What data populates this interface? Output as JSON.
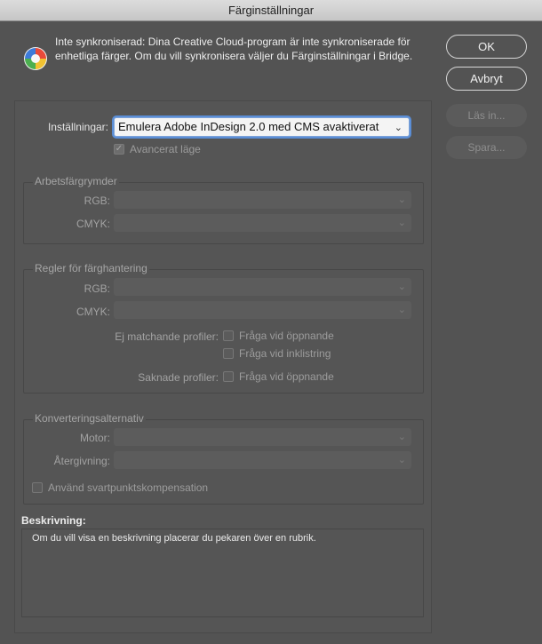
{
  "window": {
    "title": "Färginställningar"
  },
  "info": {
    "icon": "color-wheel-icon",
    "text": "Inte synkroniserad: Dina Creative Cloud-program är inte synkroniserade för enhetliga färger. Om du vill synkronisera väljer du Färginställningar i Bridge."
  },
  "buttons": {
    "ok": "OK",
    "cancel": "Avbryt",
    "load": "Läs in...",
    "save": "Spara..."
  },
  "settings": {
    "label": "Inställningar:",
    "value": "Emulera Adobe InDesign 2.0 med CMS avaktiverat",
    "advanced_label": "Avancerat läge",
    "advanced_checked": true
  },
  "working_spaces": {
    "legend": "Arbetsfärgrymder",
    "rgb_label": "RGB:",
    "cmyk_label": "CMYK:"
  },
  "policies": {
    "legend": "Regler för färghantering",
    "rgb_label": "RGB:",
    "cmyk_label": "CMYK:",
    "mismatch_label": "Ej matchande profiler:",
    "ask_open": "Fråga vid öppnande",
    "ask_paste": "Fråga vid inklistring",
    "missing_label": "Saknade profiler:",
    "ask_open_missing": "Fråga vid öppnande"
  },
  "conversion": {
    "legend": "Konverteringsalternativ",
    "engine_label": "Motor:",
    "intent_label": "Återgivning:",
    "bpc_label": "Använd svartpunktskompensation"
  },
  "description": {
    "title": "Beskrivning:",
    "text": "Om du vill visa en beskrivning placerar du pekaren över en rubrik."
  },
  "colors": {
    "background": "#535353",
    "titlebar": "#d0d0d0",
    "focus_ring": "#5b8ed6"
  }
}
